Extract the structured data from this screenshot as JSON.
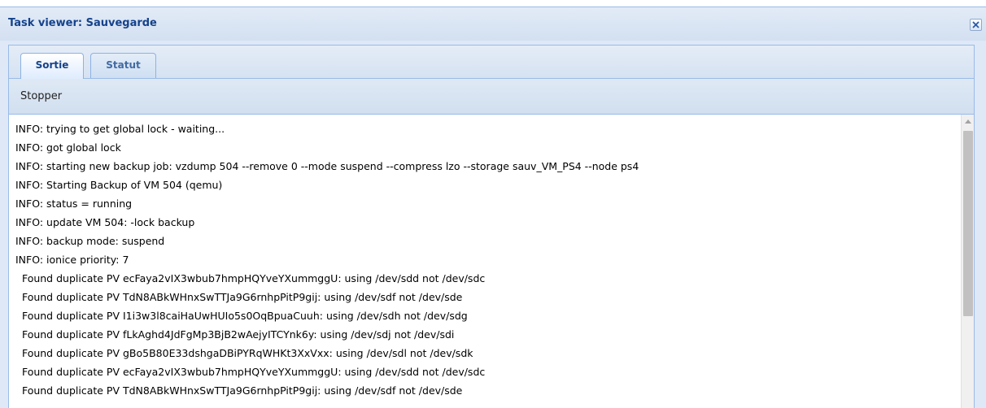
{
  "window": {
    "title": "Task viewer: Sauvegarde",
    "close_icon": "close-icon"
  },
  "tabs": [
    {
      "label": "Sortie",
      "active": true
    },
    {
      "label": "Statut",
      "active": false
    }
  ],
  "toolbar": {
    "stop_label": "Stopper"
  },
  "log": {
    "lines": [
      "INFO: trying to get global lock - waiting...",
      "INFO: got global lock",
      "INFO: starting new backup job: vzdump 504 --remove 0 --mode suspend --compress lzo --storage sauv_VM_PS4 --node ps4",
      "INFO: Starting Backup of VM 504 (qemu)",
      "INFO: status = running",
      "INFO: update VM 504: -lock backup",
      "INFO: backup mode: suspend",
      "INFO: ionice priority: 7",
      "  Found duplicate PV ecFaya2vIX3wbub7hmpHQYveYXummggU: using /dev/sdd not /dev/sdc",
      "  Found duplicate PV TdN8ABkWHnxSwTTJa9G6rnhpPitP9gij: using /dev/sdf not /dev/sde",
      "  Found duplicate PV I1i3w3l8caiHaUwHUIo5s0OqBpuaCuuh: using /dev/sdh not /dev/sdg",
      "  Found duplicate PV fLkAghd4JdFgMp3BjB2wAejyITCYnk6y: using /dev/sdj not /dev/sdi",
      "  Found duplicate PV gBo5B80E33dshgaDBiPYRqWHKt3XxVxx: using /dev/sdl not /dev/sdk",
      "  Found duplicate PV ecFaya2vIX3wbub7hmpHQYveYXummggU: using /dev/sdd not /dev/sdc",
      "  Found duplicate PV TdN8ABkWHnxSwTTJa9G6rnhpPitP9gij: using /dev/sdf not /dev/sde"
    ]
  },
  "colors": {
    "title": "#15428b",
    "border": "#99bbe8",
    "header_bg": "#dfe8f6"
  }
}
